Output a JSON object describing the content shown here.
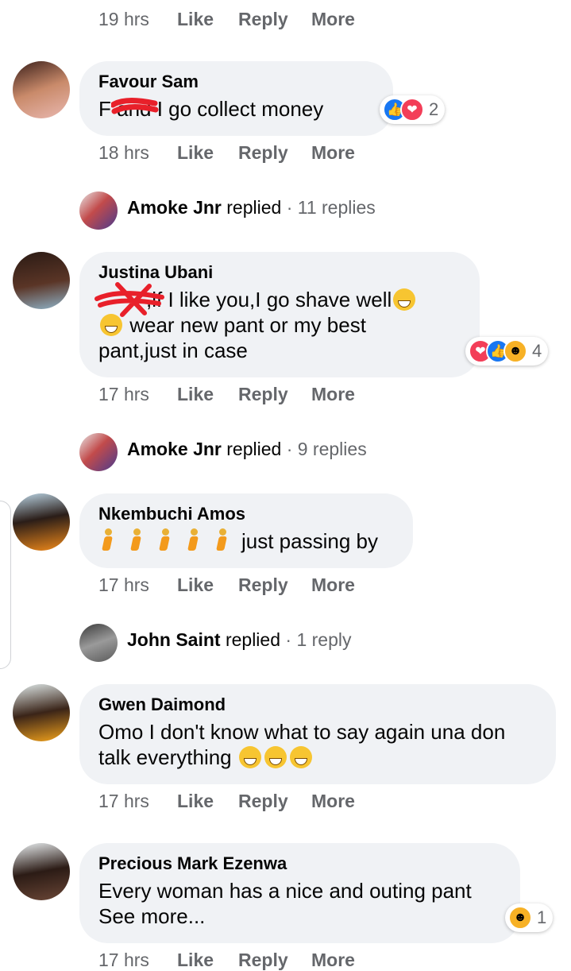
{
  "top_actions": {
    "time": "19 hrs",
    "like": "Like",
    "reply": "Reply",
    "more": "More"
  },
  "comments": [
    {
      "name": "Favour Sam",
      "text": "F and I go collect money",
      "reaction_count": "2",
      "time": "18 hrs",
      "like": "Like",
      "reply": "Reply",
      "more": "More",
      "thread": {
        "name": "Amoke Jnr",
        "verb": "replied",
        "count": "· 11 replies"
      }
    },
    {
      "name": "Justina Ubani",
      "line1": ",if I like you,I go shave well",
      "line2": "wear new pant or my best",
      "line3": "pant,just in case",
      "reaction_count": "4",
      "time": "17 hrs",
      "like": "Like",
      "reply": "Reply",
      "more": "More",
      "thread": {
        "name": "Amoke Jnr",
        "verb": "replied",
        "count": "· 9 replies"
      }
    },
    {
      "name": "Nkembuchi Amos",
      "text": "just passing by",
      "time": "17 hrs",
      "like": "Like",
      "reply": "Reply",
      "more": "More",
      "thread": {
        "name": "John Saint",
        "verb": "replied",
        "count": "· 1 reply"
      }
    },
    {
      "name": "Gwen Daimond",
      "line1": "Omo I don't know what to say again una don",
      "line2": "talk everything",
      "time": "17 hrs",
      "like": "Like",
      "reply": "Reply",
      "more": "More"
    },
    {
      "name": "Precious Mark Ezenwa",
      "line1": "Every woman has a nice and outing pant",
      "line2": "See more...",
      "reaction_count": "1",
      "time": "17 hrs",
      "like": "Like",
      "reply": "Reply",
      "more": "More"
    }
  ],
  "colors": {
    "bubble": "#f0f2f5",
    "meta_text": "#65676b",
    "like": "#1877f2",
    "love": "#f33e58",
    "haha": "#f7b125",
    "redaction": "#e8202a"
  },
  "icons": [
    "like-reaction-icon",
    "love-reaction-icon",
    "haha-reaction-icon",
    "grin-emoji-icon",
    "person-walking-emoji-icon",
    "persevere-emoji-icon"
  ]
}
